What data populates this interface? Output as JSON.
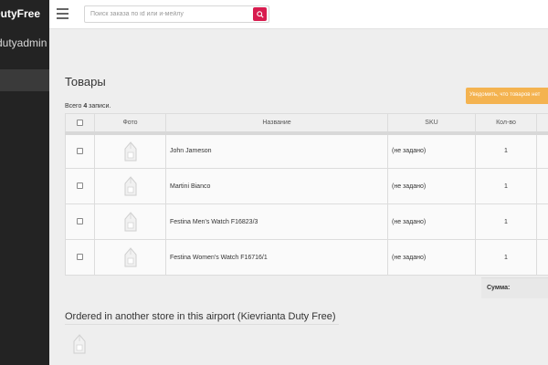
{
  "sidebar": {
    "brand": "DutyFree",
    "user": "dutyadmin"
  },
  "header": {
    "search_placeholder": "Поиск заказа по id или и-мейлу"
  },
  "page": {
    "title": "Товары",
    "notify_button": "Уведомить, что товаров нет",
    "summary_prefix": "Всего ",
    "summary_count": "4",
    "summary_suffix": " записи."
  },
  "table": {
    "columns": [
      "",
      "Фото",
      "Название",
      "SKU",
      "Кол-во"
    ],
    "rows": [
      {
        "name": "John Jameson",
        "sku": "(не задано)",
        "qty": "1"
      },
      {
        "name": "Martini Bianco",
        "sku": "(не задано)",
        "qty": "1"
      },
      {
        "name": "Festina Men's Watch F16823/3",
        "sku": "(не задано)",
        "qty": "1"
      },
      {
        "name": "Festina Women's Watch F16716/1",
        "sku": "(не задано)",
        "qty": "1"
      }
    ],
    "sum_label": "Сумма:"
  },
  "other_store": {
    "title": "Ordered in another store in this airport (Kievrianta Duty Free)"
  },
  "colors": {
    "sidebar": "#232323",
    "accent_red": "#d81c4f",
    "orange": "#f4b350"
  },
  "icons": {
    "menu": "hamburger-icon",
    "search": "search-icon",
    "photo": "image-placeholder-icon"
  }
}
